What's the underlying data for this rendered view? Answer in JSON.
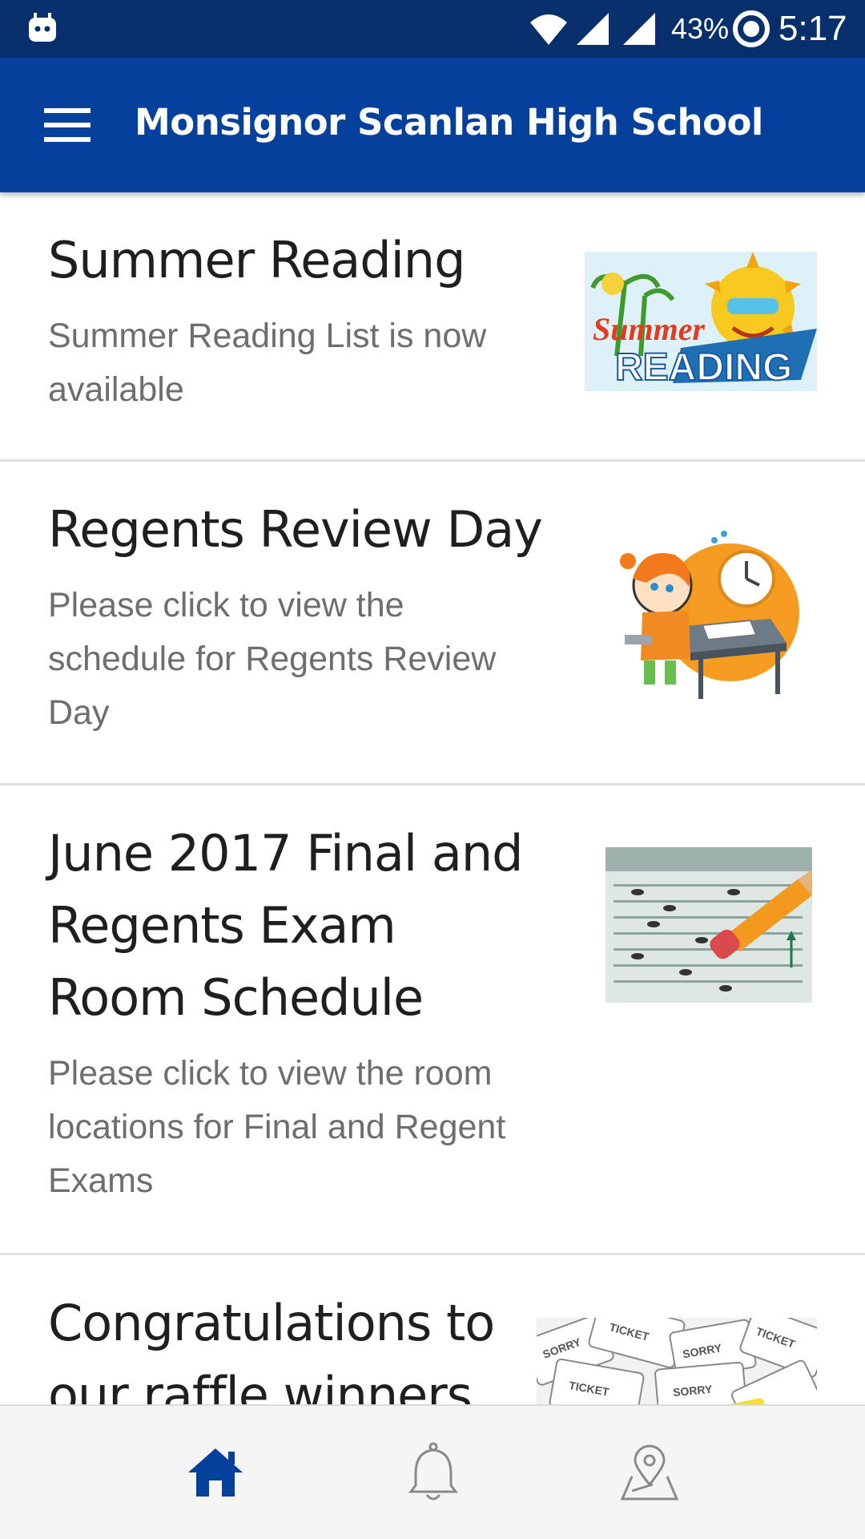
{
  "status_bar": {
    "battery": "43%",
    "time": "5:17",
    "icons": [
      "android-notification-icon",
      "wifi-icon",
      "cell-signal-icon",
      "cell-signal-icon",
      "sync-icon"
    ]
  },
  "app_bar": {
    "title": "Monsignor Scanlan High School",
    "menu_icon": "hamburger-menu-icon"
  },
  "feed": {
    "items": [
      {
        "title": "Summer Reading",
        "summary": "Summer Reading List is now available",
        "image": "summer-reading-image",
        "image_text": [
          "Summer",
          "READING"
        ]
      },
      {
        "title": "Regents Review Day",
        "summary": "Please click to view the schedule for Regents Review Day",
        "image": "student-taking-test-image"
      },
      {
        "title": "June 2017 Final and Regents Exam Room Schedule",
        "summary": "Please click to view the room locations for Final and Regent Exams",
        "image": "answer-sheet-pencil-image"
      },
      {
        "title": "Congratulations to our raffle winners",
        "summary": "",
        "image": "raffle-tickets-image"
      }
    ]
  },
  "bottom_nav": {
    "tabs": [
      {
        "name": "home",
        "icon": "home-icon",
        "active": true
      },
      {
        "name": "notifications",
        "icon": "bell-icon",
        "active": false
      },
      {
        "name": "location",
        "icon": "map-pin-icon",
        "active": false
      }
    ],
    "active_color": "#05419c",
    "inactive_color": "#8a8a8a"
  },
  "colors": {
    "status_bar": "#072f6b",
    "app_bar": "#05419c",
    "divider": "#e1e1e1"
  }
}
